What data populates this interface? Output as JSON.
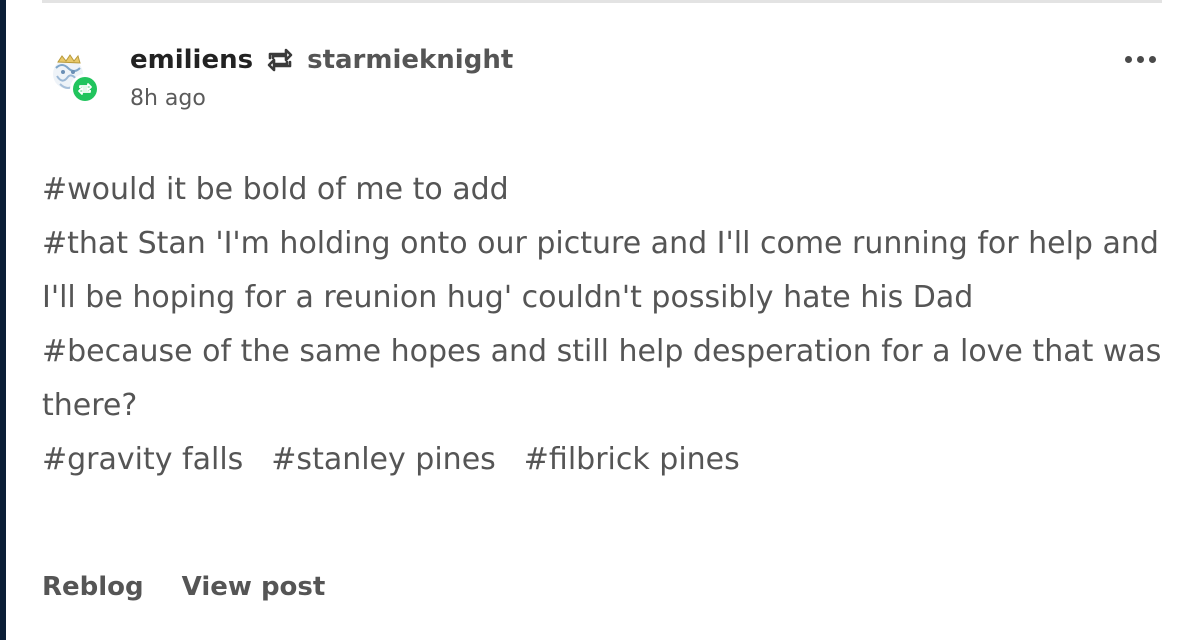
{
  "post": {
    "author": "emiliens",
    "reblogged_from": "starmieknight",
    "time": "8h ago",
    "tags": [
      "#would it be bold of me to add",
      "#that Stan 'I'm holding onto our picture and I'll come running for help and I'll be hoping for a reunion hug' couldn't possibly hate his Dad",
      "#because of the same hopes and still help desperation for a love that was there?"
    ],
    "tag_row": [
      "#gravity falls",
      "#stanley pines",
      "#filbrick pines"
    ]
  },
  "footer": {
    "reblog_label": "Reblog",
    "view_post_label": "View post"
  },
  "icons": {
    "reblog": "reblog-icon",
    "more": "more-options-icon",
    "avatar": "avatar"
  },
  "colors": {
    "reblog_badge": "#21c45d",
    "left_bar": "#0b1e36"
  }
}
